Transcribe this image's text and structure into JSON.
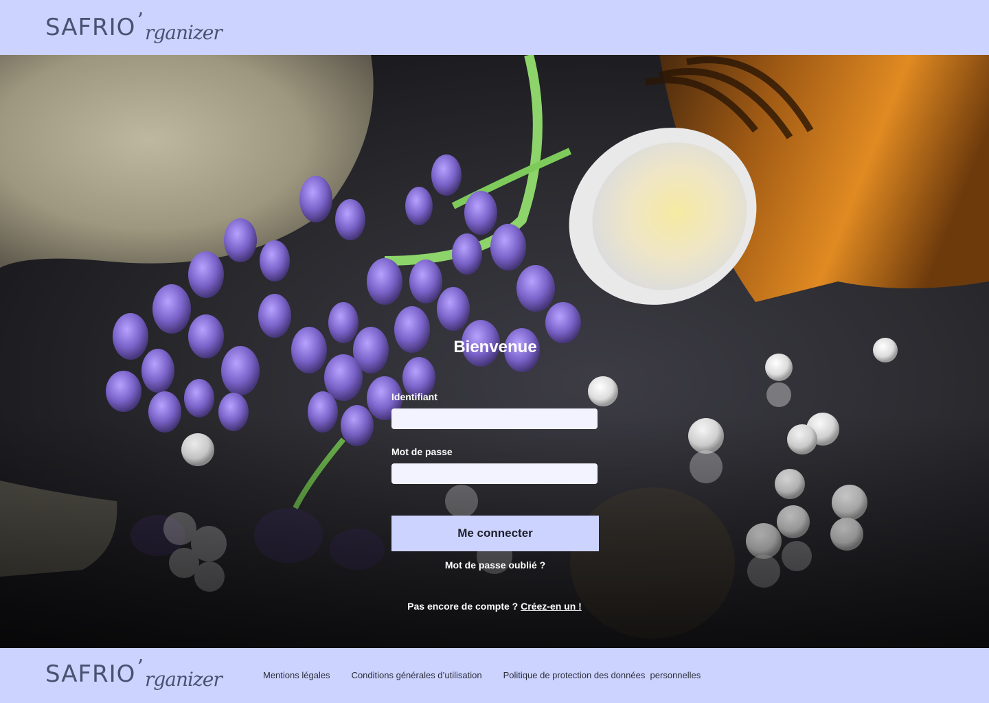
{
  "brand": {
    "name_main": "SAFRIO",
    "apostrophe": "’",
    "name_script": "rganizer"
  },
  "colors": {
    "bar_background": "#ccd3ff",
    "input_background": "#f2f3ff",
    "button_background": "#ccd3ff",
    "text_light": "#ffffff",
    "logo_color": "#4b5170"
  },
  "hero": {
    "image": "lavender-flowers-and-homeopathy-bottle-photo"
  },
  "login": {
    "title": "Bienvenue",
    "username_label": "Identifiant",
    "username_value": "",
    "password_label": "Mot de passe",
    "password_value": "",
    "submit_label": "Me connecter",
    "forgot_password": "Mot de passe oublié ?",
    "signup_prompt": "Pas encore de compte ?",
    "signup_link": "Créez-en un !"
  },
  "footer": {
    "links": [
      "Mentions légales",
      "Conditions générales d’utilisation",
      "Politique de protection des données  personnelles"
    ]
  }
}
